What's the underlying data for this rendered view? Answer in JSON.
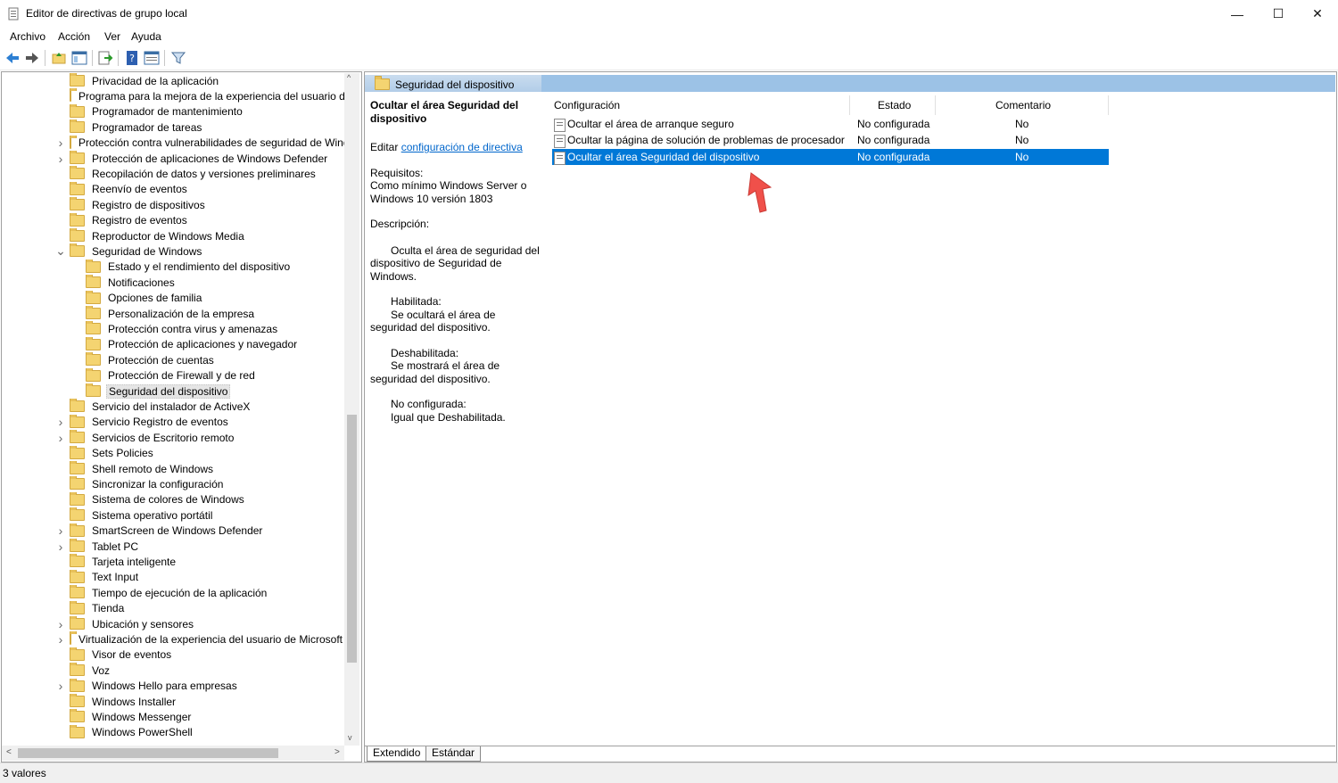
{
  "window": {
    "title": "Editor de directivas de grupo local",
    "minimize": "—",
    "maximize": "☐",
    "close": "✕"
  },
  "menu": [
    "Archivo",
    "Acción",
    "Ver",
    "Ayuda"
  ],
  "toolbar": [
    "back-icon",
    "forward-icon",
    "up-folder-icon",
    "show-hide-tree-icon",
    "export-list-icon",
    "help-icon",
    "properties-icon",
    "filter-icon"
  ],
  "tree": [
    {
      "label": "Privacidad de la aplicación",
      "level": 0,
      "expander": ""
    },
    {
      "label": "Programa para la mejora de la experiencia del usuario de",
      "level": 0,
      "expander": ""
    },
    {
      "label": "Programador de mantenimiento",
      "level": 0,
      "expander": ""
    },
    {
      "label": "Programador de tareas",
      "level": 0,
      "expander": ""
    },
    {
      "label": "Protección contra vulnerabilidades de seguridad de Windo",
      "level": 0,
      "expander": ">"
    },
    {
      "label": "Protección de aplicaciones de Windows Defender",
      "level": 0,
      "expander": ">"
    },
    {
      "label": "Recopilación de datos y versiones preliminares",
      "level": 0,
      "expander": ""
    },
    {
      "label": "Reenvío de eventos",
      "level": 0,
      "expander": ""
    },
    {
      "label": "Registro de dispositivos",
      "level": 0,
      "expander": ""
    },
    {
      "label": "Registro de eventos",
      "level": 0,
      "expander": ""
    },
    {
      "label": "Reproductor de Windows Media",
      "level": 0,
      "expander": ""
    },
    {
      "label": "Seguridad de Windows",
      "level": 0,
      "expander": "v"
    },
    {
      "label": "Estado y el rendimiento del dispositivo",
      "level": 1,
      "expander": ""
    },
    {
      "label": "Notificaciones",
      "level": 1,
      "expander": ""
    },
    {
      "label": "Opciones de familia",
      "level": 1,
      "expander": ""
    },
    {
      "label": "Personalización de la empresa",
      "level": 1,
      "expander": ""
    },
    {
      "label": "Protección contra virus y amenazas",
      "level": 1,
      "expander": ""
    },
    {
      "label": "Protección de aplicaciones y navegador",
      "level": 1,
      "expander": ""
    },
    {
      "label": "Protección de cuentas",
      "level": 1,
      "expander": ""
    },
    {
      "label": "Protección de Firewall y de red",
      "level": 1,
      "expander": ""
    },
    {
      "label": "Seguridad del dispositivo",
      "level": 1,
      "expander": "",
      "selected": true
    },
    {
      "label": "Servicio del instalador de ActiveX",
      "level": 0,
      "expander": ""
    },
    {
      "label": "Servicio Registro de eventos",
      "level": 0,
      "expander": ">"
    },
    {
      "label": "Servicios de Escritorio remoto",
      "level": 0,
      "expander": ">"
    },
    {
      "label": "Sets Policies",
      "level": 0,
      "expander": ""
    },
    {
      "label": "Shell remoto de Windows",
      "level": 0,
      "expander": ""
    },
    {
      "label": "Sincronizar la configuración",
      "level": 0,
      "expander": ""
    },
    {
      "label": "Sistema de colores de Windows",
      "level": 0,
      "expander": ""
    },
    {
      "label": "Sistema operativo portátil",
      "level": 0,
      "expander": ""
    },
    {
      "label": "SmartScreen de Windows Defender",
      "level": 0,
      "expander": ">"
    },
    {
      "label": "Tablet PC",
      "level": 0,
      "expander": ">"
    },
    {
      "label": "Tarjeta inteligente",
      "level": 0,
      "expander": ""
    },
    {
      "label": "Text Input",
      "level": 0,
      "expander": ""
    },
    {
      "label": "Tiempo de ejecución de la aplicación",
      "level": 0,
      "expander": ""
    },
    {
      "label": "Tienda",
      "level": 0,
      "expander": ""
    },
    {
      "label": "Ubicación y sensores",
      "level": 0,
      "expander": ">"
    },
    {
      "label": "Virtualización de la experiencia del usuario de Microsoft",
      "level": 0,
      "expander": ">"
    },
    {
      "label": "Visor de eventos",
      "level": 0,
      "expander": ""
    },
    {
      "label": "Voz",
      "level": 0,
      "expander": ""
    },
    {
      "label": "Windows Hello para empresas",
      "level": 0,
      "expander": ">"
    },
    {
      "label": "Windows Installer",
      "level": 0,
      "expander": ""
    },
    {
      "label": "Windows Messenger",
      "level": 0,
      "expander": ""
    },
    {
      "label": "Windows PowerShell",
      "level": 0,
      "expander": ""
    }
  ],
  "right": {
    "header_title": "Seguridad del dispositivo",
    "desc": {
      "policy_title": "Ocultar el área Seguridad del dispositivo",
      "edit_prefix": "Editar ",
      "edit_link": "configuración de directiva",
      "requirements_label": "Requisitos:",
      "requirements_text": "Como mínimo Windows Server o Windows 10 versión 1803",
      "description_label": "Descripción:",
      "p1": "Oculta el área de seguridad del dispositivo de Seguridad de Windows.",
      "enabled_label": "Habilitada:",
      "enabled_text": "Se ocultará el área de seguridad del dispositivo.",
      "disabled_label": "Deshabilitada:",
      "disabled_text": "Se mostrará el área de seguridad del dispositivo.",
      "notconf_label": "No configurada:",
      "notconf_text": "Igual que Deshabilitada."
    },
    "columns": {
      "setting": "Configuración",
      "state": "Estado",
      "comment": "Comentario"
    },
    "rows": [
      {
        "setting": "Ocultar el área de arranque seguro",
        "state": "No configurada",
        "comment": "No"
      },
      {
        "setting": "Ocultar la página de solución de problemas de procesador (...",
        "state": "No configurada",
        "comment": "No"
      },
      {
        "setting": "Ocultar el área Seguridad del dispositivo",
        "state": "No configurada",
        "comment": "No",
        "selected": true
      }
    ],
    "tabs": [
      "Extendido",
      "Estándar"
    ]
  },
  "status": "3 valores",
  "colors": {
    "selection": "#0078d7",
    "header_band": "#9cc2e6",
    "folder": "#f4d471",
    "arrow": "#f0504a"
  }
}
